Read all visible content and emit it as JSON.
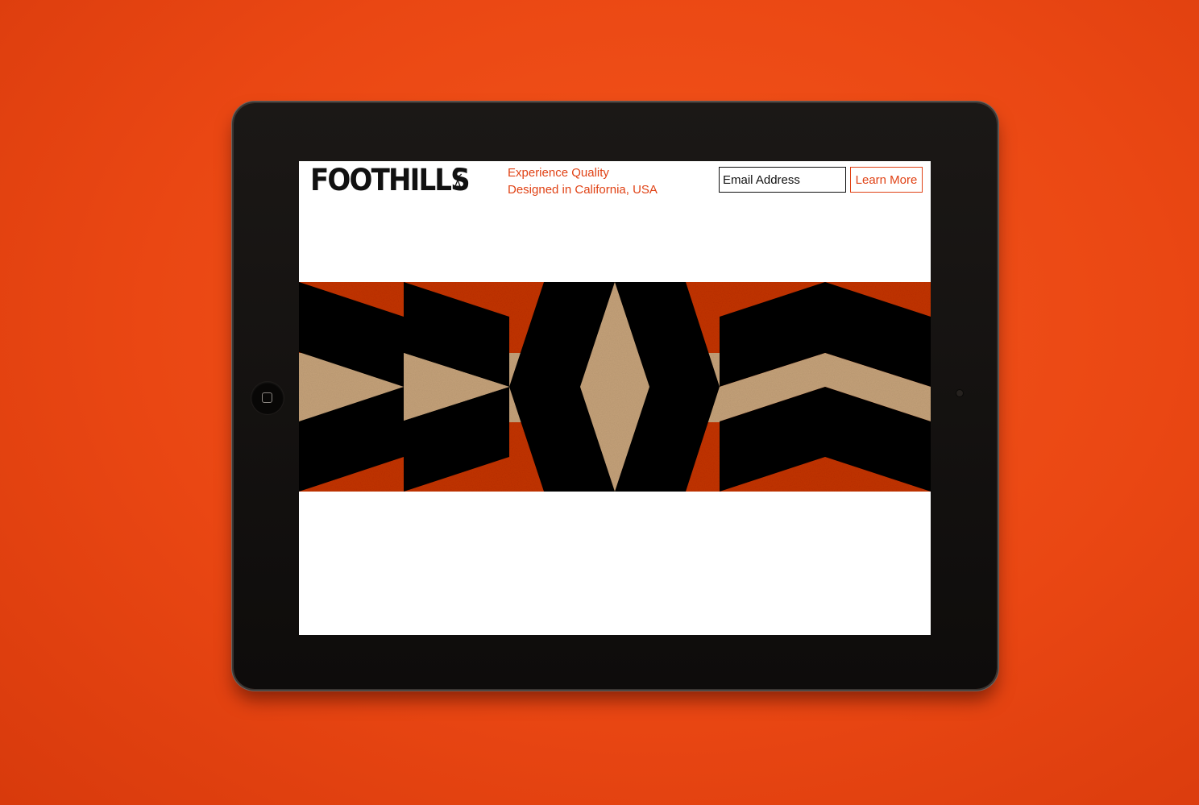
{
  "site": {
    "logo_text": "FOOTHILLS",
    "logo_sub": [
      "C",
      "A"
    ],
    "tagline": [
      "Experience Quality",
      "Designed in California, USA"
    ]
  },
  "signup": {
    "email_placeholder": "Email Address",
    "button_label": "Learn More"
  },
  "colors": {
    "brand_accent": "#e04215",
    "banner_red": "#c43410",
    "banner_black": "#0a0908",
    "banner_kraft": "#c6a37a",
    "backdrop": "#ea4713"
  },
  "icons": [
    "home-button-icon",
    "camera-icon"
  ]
}
